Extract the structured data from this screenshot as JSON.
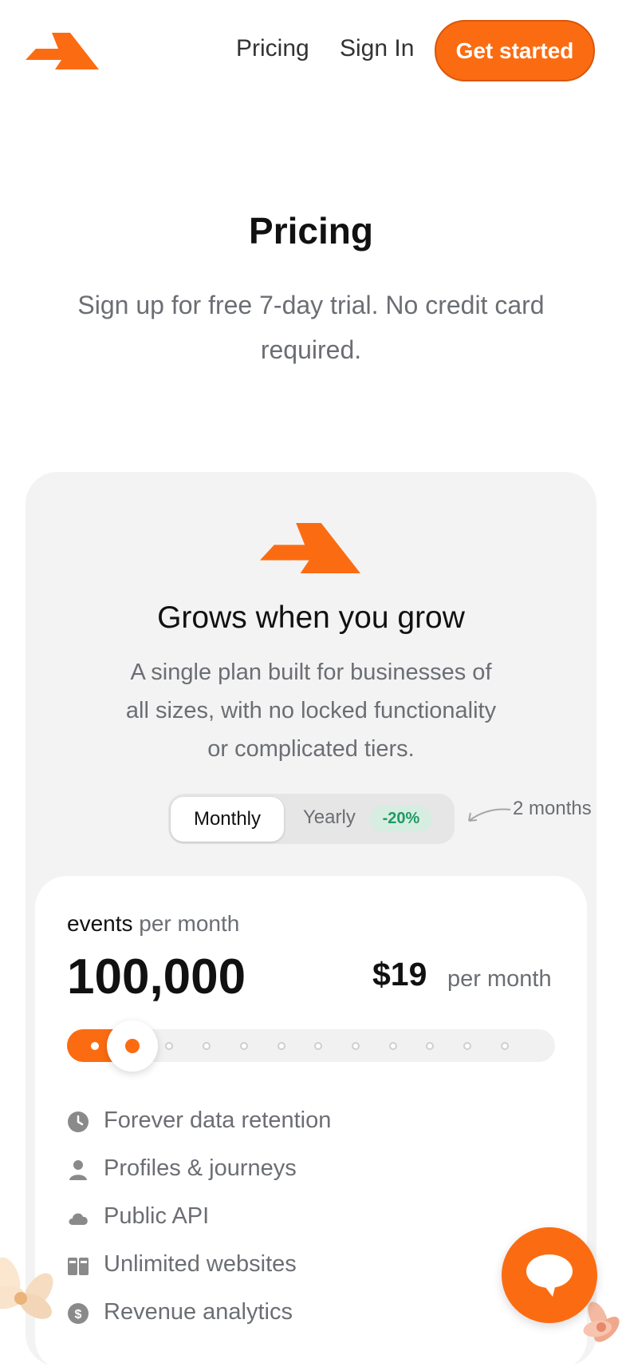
{
  "nav": {
    "links": [
      "Pricing",
      "Sign In"
    ],
    "cta_label": "Get started"
  },
  "hero": {
    "title": "Pricing",
    "subtitle": "Sign up for free 7-day trial. No credit card required."
  },
  "plan": {
    "title": "Grows when you grow",
    "description": "A single plan built for businesses of all sizes, with no locked functionality or complicated tiers.",
    "billing_toggle": {
      "options": [
        "Monthly",
        "Yearly"
      ],
      "selected": "Monthly",
      "yearly_badge": "-20%",
      "note": "2 months"
    },
    "card": {
      "events_label": "events",
      "events_suffix": "per month",
      "events_value": "100,000",
      "price": "$19",
      "price_unit": "per month",
      "slider": {
        "steps": 12,
        "selected_step": 2
      },
      "features": [
        {
          "icon": "clock-icon",
          "label": "Forever data retention"
        },
        {
          "icon": "user-icon",
          "label": "Profiles & journeys"
        },
        {
          "icon": "cloud-icon",
          "label": "Public API"
        },
        {
          "icon": "browser-windows-icon",
          "label": "Unlimited websites"
        },
        {
          "icon": "dollar-icon",
          "label": "Revenue analytics"
        }
      ]
    }
  },
  "colors": {
    "accent": "#fb6c12",
    "muted_text": "#6b6e73",
    "panel_bg": "#f3f3f3",
    "badge_bg": "#d7ede2",
    "badge_text": "#1f9a63"
  }
}
